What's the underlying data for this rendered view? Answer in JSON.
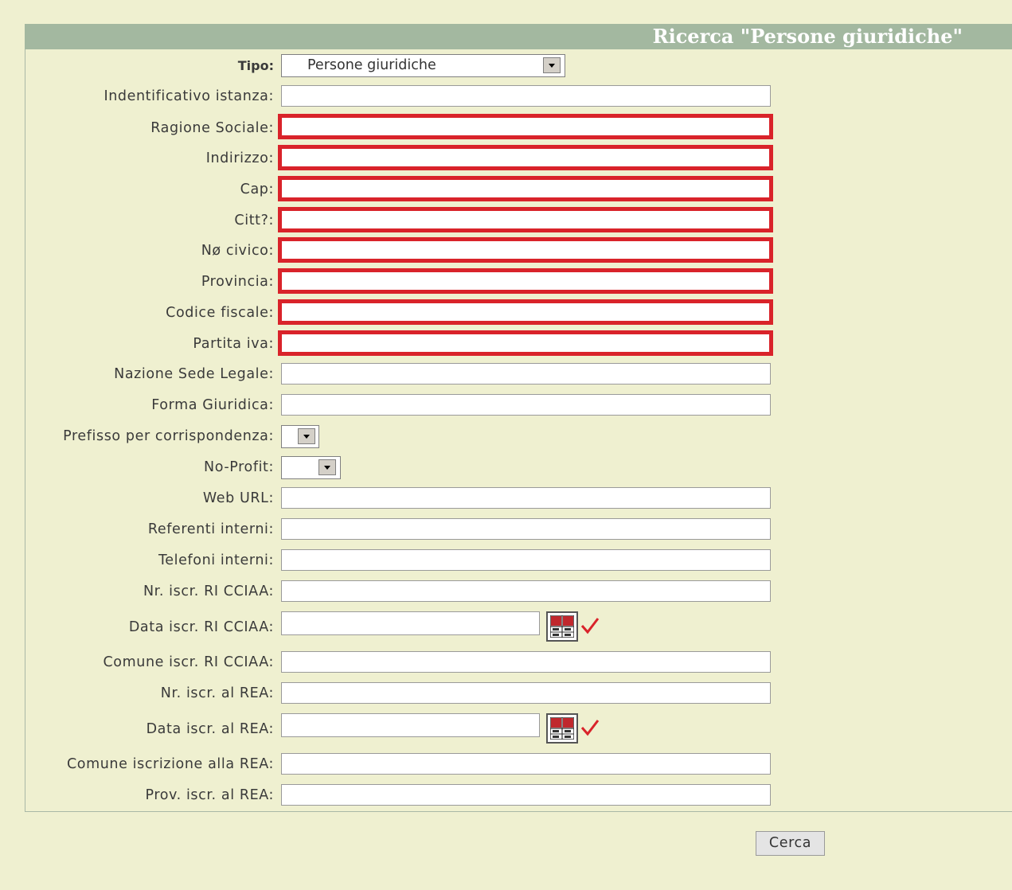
{
  "header": {
    "title": "Ricerca \"Persone giuridiche\""
  },
  "form": {
    "tipo": {
      "label": "Tipo:",
      "value": "Persone giuridiche"
    },
    "fields": {
      "identificativo": "Indentificativo istanza:",
      "ragione_sociale": "Ragione Sociale:",
      "indirizzo": "Indirizzo:",
      "cap": "Cap:",
      "citta": "Citt?:",
      "civico": "Nø civico:",
      "provincia": "Provincia:",
      "codice_fiscale": "Codice fiscale:",
      "partita_iva": "Partita iva:",
      "nazione": "Nazione Sede Legale:",
      "forma_giuridica": "Forma Giuridica:",
      "prefisso": "Prefisso per corrispondenza:",
      "no_profit": "No-Profit:",
      "web_url": "Web URL:",
      "referenti": "Referenti interni:",
      "telefoni": "Telefoni interni:",
      "nr_ri": "Nr. iscr. RI CCIAA:",
      "data_ri": "Data iscr. RI CCIAA:",
      "comune_ri": "Comune iscr. RI CCIAA:",
      "nr_rea": "Nr. iscr. al REA:",
      "data_rea": "Data iscr. al REA:",
      "comune_rea": "Comune iscrizione alla REA:",
      "prov_rea": "Prov. iscr. al REA:"
    },
    "icons": {
      "calendar": "calendar-icon",
      "check": "checkmark-icon",
      "dropdown": "chevron-down-icon"
    },
    "colors": {
      "required_border": "#d9232a",
      "header_bg": "#a3b8a0",
      "page_bg": "#eff0d0"
    }
  },
  "actions": {
    "search_label": "Cerca"
  }
}
